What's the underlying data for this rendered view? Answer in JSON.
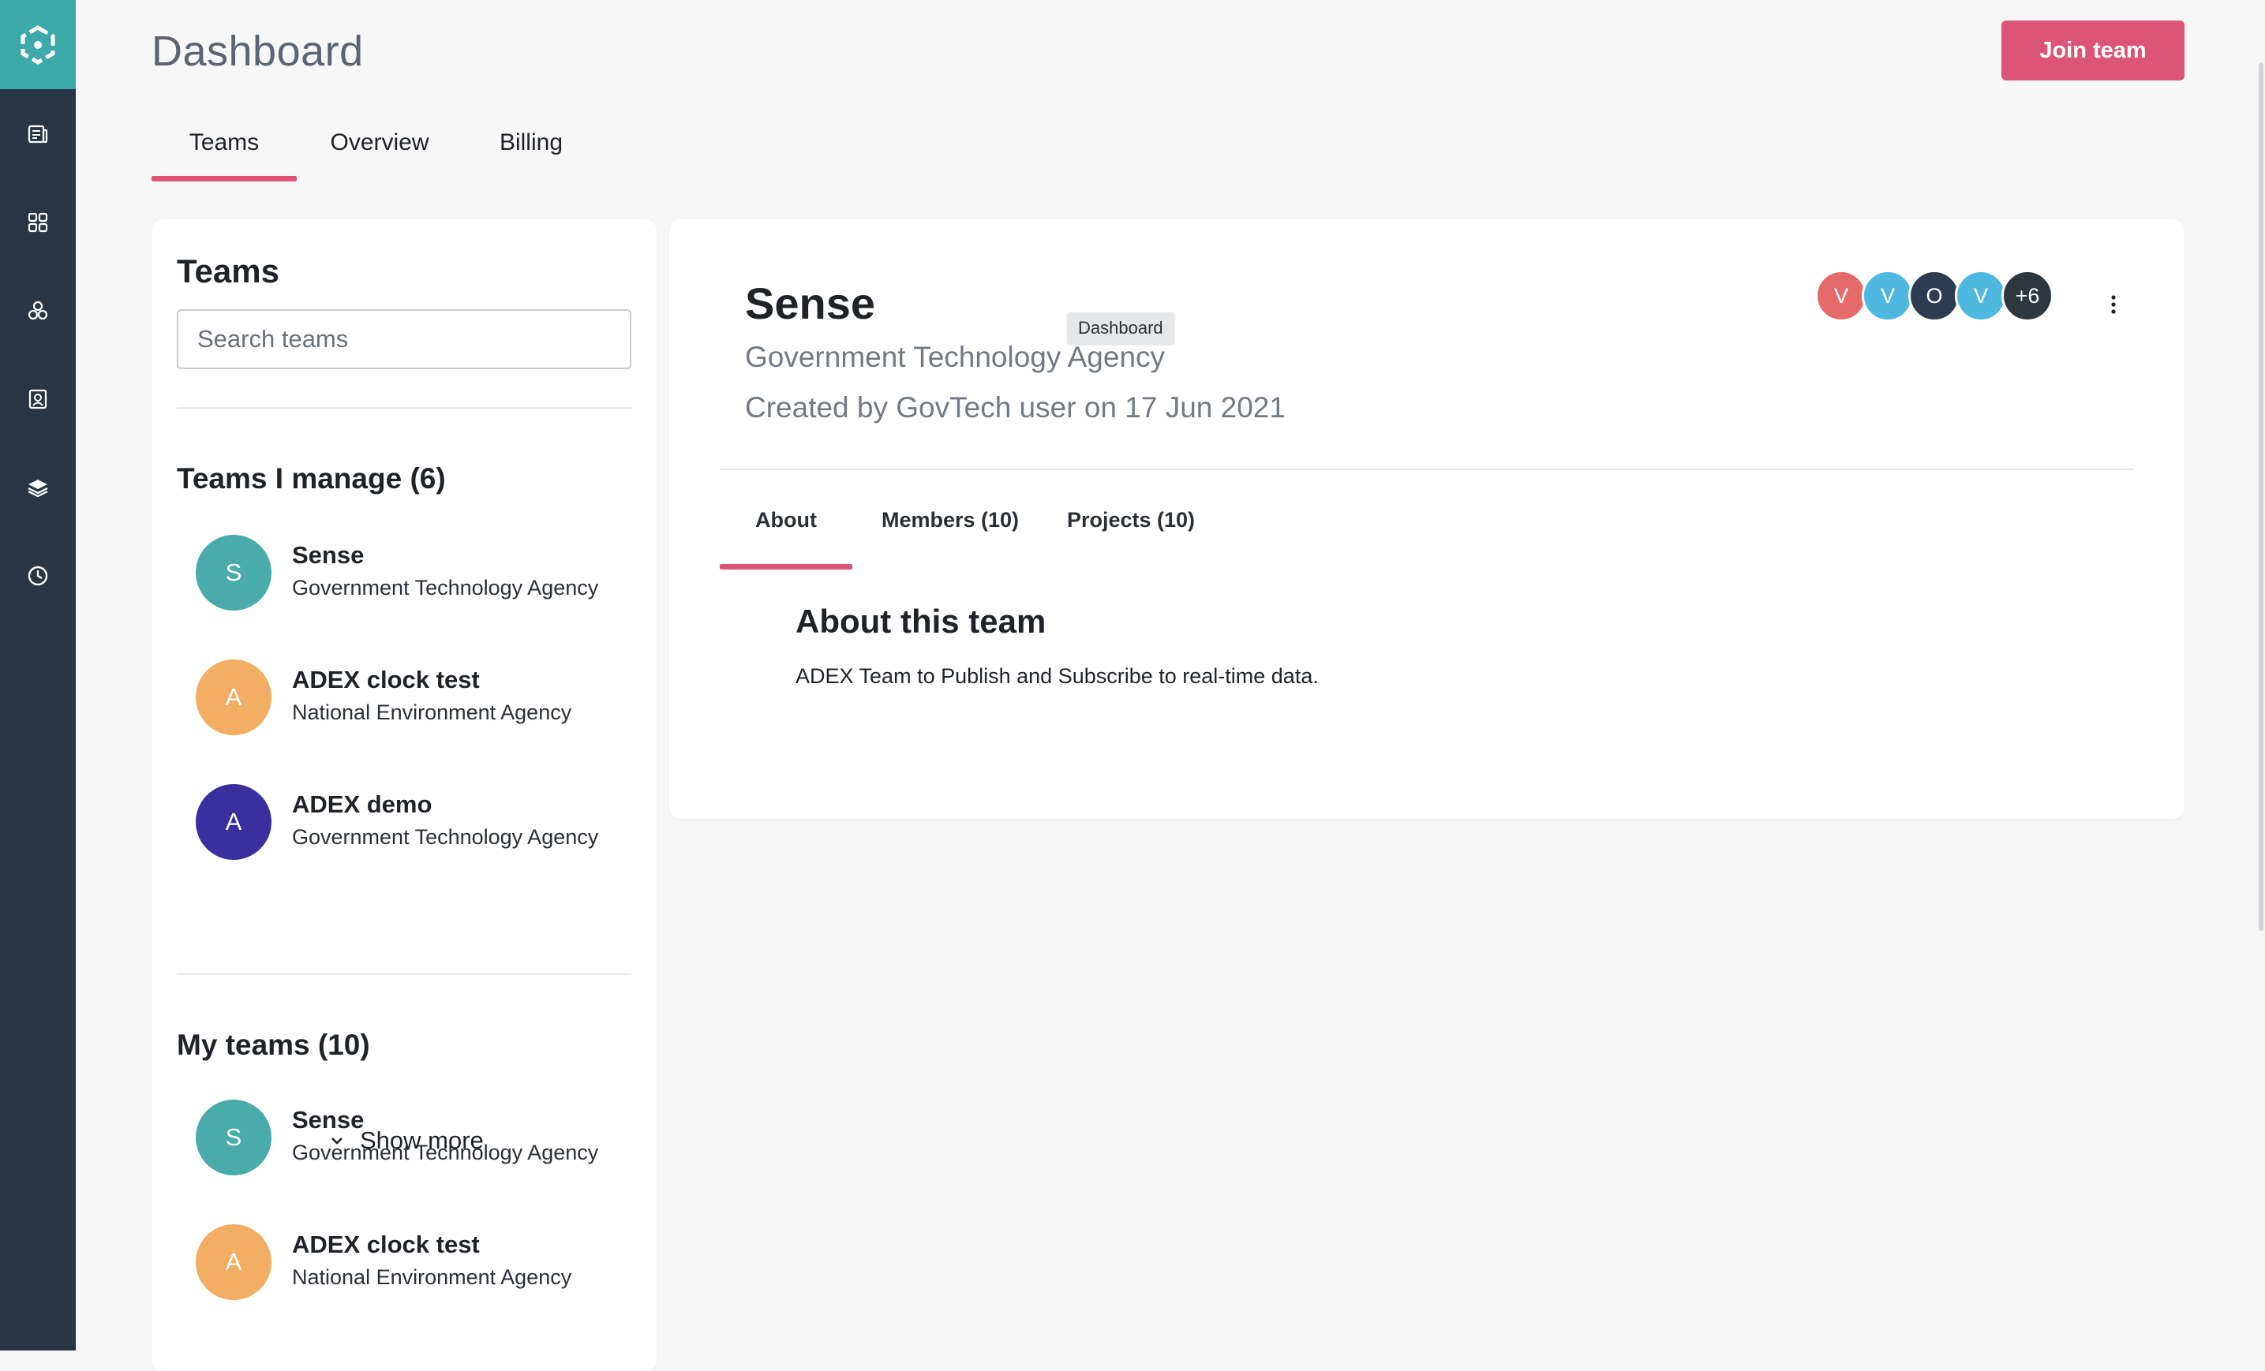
{
  "header": {
    "title": "Dashboard",
    "join_button": "Join team"
  },
  "sidebar": {
    "items": [
      {
        "icon": "news-icon"
      },
      {
        "icon": "apps-grid-icon"
      },
      {
        "icon": "team-cluster-icon"
      },
      {
        "icon": "contact-book-icon"
      },
      {
        "icon": "layers-icon"
      },
      {
        "icon": "clock-icon"
      }
    ]
  },
  "main_tabs": [
    {
      "label": "Teams",
      "active": true
    },
    {
      "label": "Overview",
      "active": false
    },
    {
      "label": "Billing",
      "active": false
    }
  ],
  "teams_panel": {
    "title": "Teams",
    "search_placeholder": "Search teams",
    "manage_section": "Teams I manage (6)",
    "manage_teams": [
      {
        "initial": "S",
        "name": "Sense",
        "org": "Government Technology Agency",
        "color": "#4aabab"
      },
      {
        "initial": "A",
        "name": "ADEX clock test",
        "org": "National Environment Agency",
        "color": "#f2ae63"
      },
      {
        "initial": "A",
        "name": "ADEX demo",
        "org": "Government Technology Agency",
        "color": "#3b2fa0"
      }
    ],
    "show_more": "Show more",
    "my_section": "My teams (10)",
    "my_teams": [
      {
        "initial": "S",
        "name": "Sense",
        "org": "Government Technology Agency",
        "color": "#4aabab"
      },
      {
        "initial": "A",
        "name": "ADEX clock test",
        "org": "National Environment Agency",
        "color": "#f2ae63"
      }
    ]
  },
  "team_detail": {
    "name": "Sense",
    "org": "Government Technology Agency",
    "created": "Created by GovTech user on 17 Jun 2021",
    "tooltip": "Dashboard",
    "members": [
      {
        "initial": "V",
        "color": "#e56b6b"
      },
      {
        "initial": "V",
        "color": "#4fb8e0"
      },
      {
        "initial": "O",
        "color": "#2c3d52"
      },
      {
        "initial": "V",
        "color": "#4fb8e0"
      },
      {
        "initial": "+6",
        "color": "#2e3640"
      }
    ],
    "tabs": [
      {
        "label": "About",
        "active": true
      },
      {
        "label": "Members (10)",
        "active": false
      },
      {
        "label": "Projects (10)",
        "active": false
      }
    ],
    "about_title": "About this team",
    "about_text": "ADEX Team to Publish and Subscribe to real-time data."
  },
  "colors": {
    "accent": "#dc5579",
    "sidebar": "#273545",
    "logo_bg": "#3ea9a9"
  }
}
